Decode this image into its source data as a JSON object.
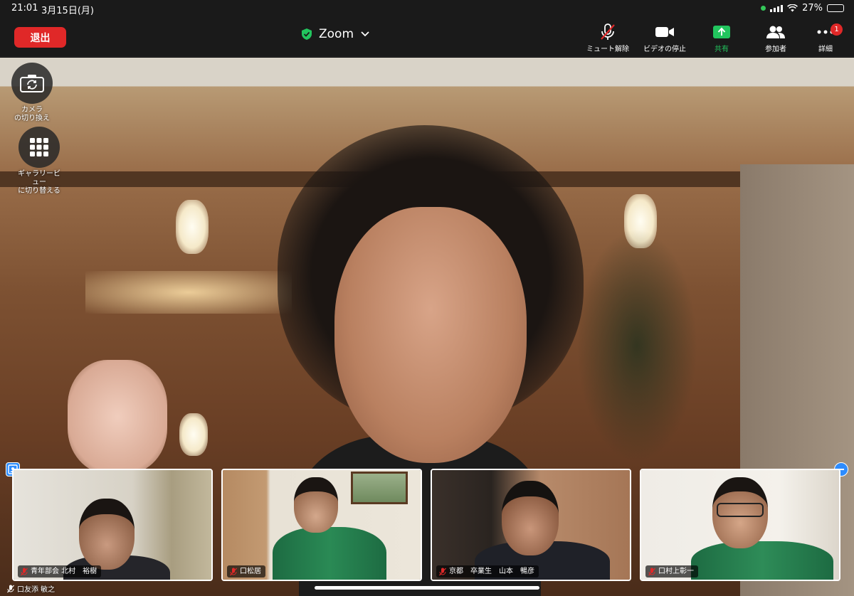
{
  "status_bar": {
    "time": "21:01",
    "date": "3月15日(月)",
    "battery": "27%",
    "battery_level": 0.27
  },
  "toolbar": {
    "leave_label": "退出",
    "meeting_title": "Zoom",
    "unmute_label": "ミュート解除",
    "stop_video_label": "ビデオの停止",
    "share_label": "共有",
    "participants_label": "参加者",
    "more_label": "詳細",
    "more_badge": "1",
    "share_color": "#22c55e",
    "leave_color": "#e02828"
  },
  "floating": {
    "switch_camera_label": "カメラ\nの切り換え",
    "switch_camera_line1": "カメラ",
    "switch_camera_line2": "の切り換え",
    "gallery_line1": "ギャラリービ",
    "gallery_line2": "ュー",
    "gallery_line3": "に切り替える"
  },
  "thumbnails": [
    {
      "name": "青年部会 北村　裕樹"
    },
    {
      "name": "口松居"
    },
    {
      "name": "京都　卒業生　山本　暢彦"
    },
    {
      "name": "口村上彰一"
    }
  ],
  "active_speaker": {
    "name": "口友添 敏之"
  }
}
